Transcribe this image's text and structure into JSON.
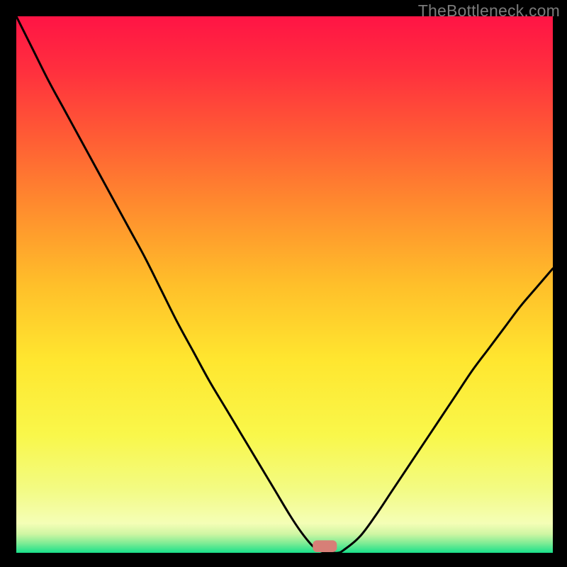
{
  "watermark": "TheBottleneck.com",
  "chart_data": {
    "type": "line",
    "title": "",
    "xlabel": "",
    "ylabel": "",
    "xlim": [
      0,
      100
    ],
    "ylim": [
      0,
      100
    ],
    "x": [
      0,
      3,
      6,
      9,
      12,
      15,
      18,
      21,
      24,
      27,
      30,
      33,
      36,
      39,
      42,
      45,
      48,
      51,
      53,
      55,
      56,
      57,
      58,
      59,
      60,
      61,
      64,
      67,
      70,
      73,
      76,
      79,
      82,
      85,
      88,
      91,
      94,
      97,
      100
    ],
    "values": [
      100,
      94,
      88,
      82.5,
      77,
      71.5,
      66,
      60.5,
      55,
      49,
      43,
      37.5,
      32,
      27,
      22,
      17,
      12,
      7,
      4,
      1.5,
      0.7,
      0.2,
      0,
      0,
      0,
      0.5,
      3,
      7,
      11.5,
      16,
      20.5,
      25,
      29.5,
      34,
      38,
      42,
      46,
      49.5,
      53
    ],
    "marker": {
      "x": 57.5,
      "width": 4.5,
      "height": 2.2,
      "color": "#d77f77"
    },
    "gradient_stops": [
      {
        "offset": 0,
        "color": "#ff1445"
      },
      {
        "offset": 0.1,
        "color": "#ff2f3e"
      },
      {
        "offset": 0.22,
        "color": "#ff5a35"
      },
      {
        "offset": 0.35,
        "color": "#ff8a2e"
      },
      {
        "offset": 0.5,
        "color": "#ffbf2a"
      },
      {
        "offset": 0.64,
        "color": "#ffe62f"
      },
      {
        "offset": 0.78,
        "color": "#f9f74a"
      },
      {
        "offset": 0.88,
        "color": "#f3fb82"
      },
      {
        "offset": 0.945,
        "color": "#f4feb6"
      },
      {
        "offset": 0.965,
        "color": "#cff6a3"
      },
      {
        "offset": 0.982,
        "color": "#7fec95"
      },
      {
        "offset": 1.0,
        "color": "#18e08a"
      }
    ]
  }
}
